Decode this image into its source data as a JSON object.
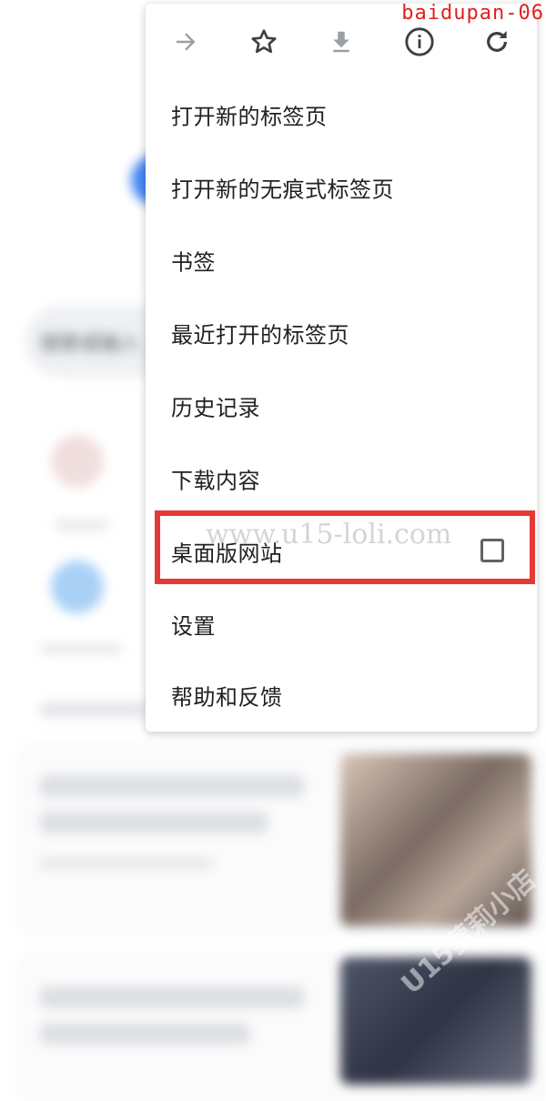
{
  "background_page": {
    "search_placeholder": "搜索或输入"
  },
  "menu": {
    "toolbar": {
      "forward_icon": "forward-arrow-icon",
      "bookmark_icon": "star-icon",
      "download_icon": "download-icon",
      "info_icon": "info-icon",
      "refresh_icon": "refresh-icon"
    },
    "items": [
      {
        "label": "打开新的标签页"
      },
      {
        "label": "打开新的无痕式标签页"
      },
      {
        "label": "书签"
      },
      {
        "label": "最近打开的标签页"
      },
      {
        "label": "历史记录"
      },
      {
        "label": "下载内容"
      },
      {
        "label": "桌面版网站",
        "checked": false
      },
      {
        "label": "设置"
      },
      {
        "label": "帮助和反馈"
      }
    ]
  },
  "overlay": {
    "corner_tag": "baidupan-06",
    "watermark": "www.u15-loli.com",
    "side_watermark": "U15萝莉小店",
    "highlight_color": "#e53935"
  },
  "colors": {
    "menu_text": "#202124",
    "icon_gray": "#5f6368",
    "disabled_gray": "#9aa0a6"
  }
}
